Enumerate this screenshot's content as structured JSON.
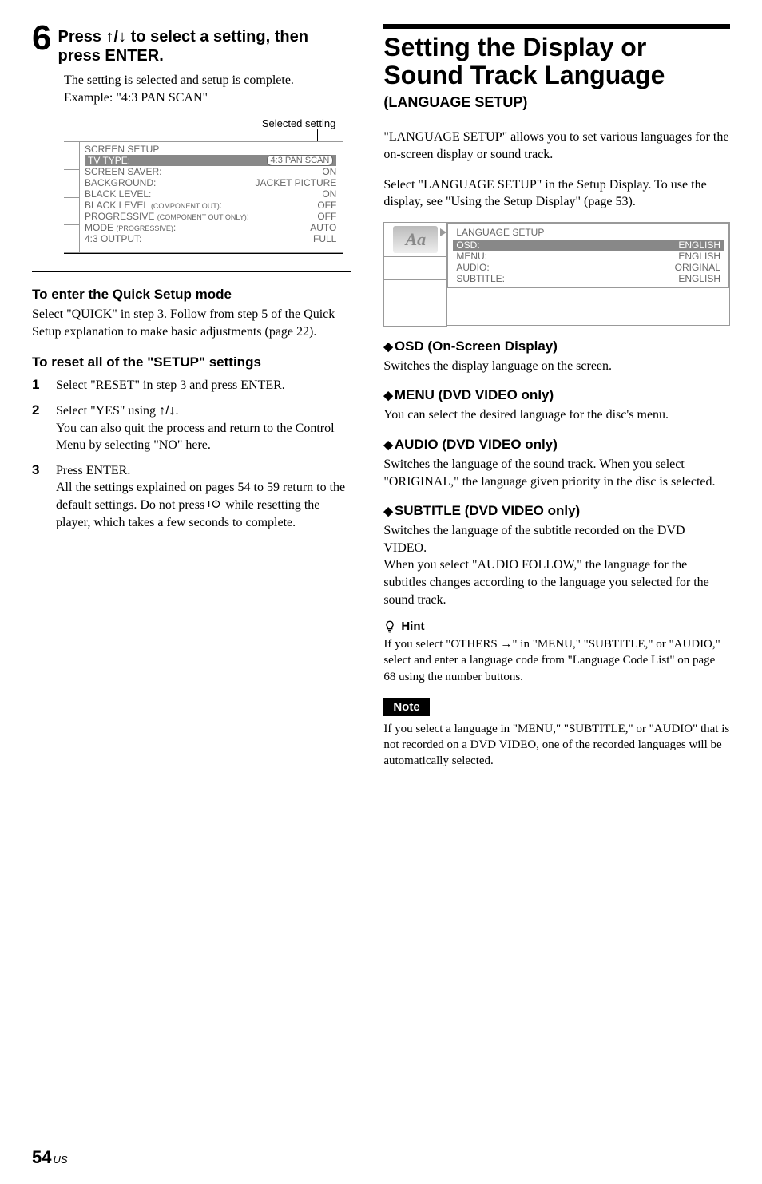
{
  "left": {
    "step_number": "6",
    "step_heading_a": "Press ",
    "step_heading_arrows": "↑/↓",
    "step_heading_b": " to select a setting, then press ENTER.",
    "body1": "The setting is selected and setup is complete.",
    "body2": "Example: \"4:3 PAN SCAN\"",
    "selected_label": "Selected setting",
    "osd": {
      "title": "SCREEN SETUP",
      "hl_label": "TV TYPE:",
      "hl_value": "4:3 PAN SCAN",
      "rows": [
        {
          "l": "SCREEN SAVER:",
          "r": "ON"
        },
        {
          "l": "BACKGROUND:",
          "r": "JACKET PICTURE"
        },
        {
          "l": "BLACK LEVEL:",
          "r": "ON"
        },
        {
          "l": "BLACK LEVEL (COMPONENT OUT):",
          "r": "OFF",
          "small": true
        },
        {
          "l": "PROGRESSIVE (COMPONENT OUT ONLY):",
          "r": "OFF",
          "small": true
        },
        {
          "l": "MODE (PROGRESSIVE):",
          "r": "AUTO",
          "small": true
        },
        {
          "l": "4:3 OUTPUT:",
          "r": "FULL"
        }
      ]
    },
    "quick_heading": "To enter the Quick Setup mode",
    "quick_body": "Select \"QUICK\" in step 3. Follow from step 5 of the Quick Setup explanation to make basic adjustments (page 22).",
    "reset_heading": "To reset all of the \"SETUP\" settings",
    "reset_steps": [
      {
        "n": "1",
        "t": "Select \"RESET\" in step 3 and press ENTER."
      },
      {
        "n": "2",
        "t_a": "Select \"YES\" using ",
        "t_arrows": "↑/↓",
        "t_b": ".\nYou can also quit the process and return to the Control Menu by selecting \"NO\" here."
      },
      {
        "n": "3",
        "t_a": "Press ENTER.\nAll the settings explained on pages 54 to 59 return to the default settings. Do not press ",
        "t_power": true,
        "t_b": " while resetting the player, which takes a few seconds to complete."
      }
    ]
  },
  "right": {
    "title1": "Setting the Display or",
    "title2": "Sound Track Language",
    "subtitle": "(LANGUAGE SETUP)",
    "intro": "\"LANGUAGE SETUP\" allows you to set various languages for the on-screen display or sound track.",
    "select_para": "Select \"LANGUAGE SETUP\" in the Setup Display. To use the display, see \"Using the Setup Display\" (page 53).",
    "menu": {
      "title": "LANGUAGE SETUP",
      "rows": [
        {
          "l": "OSD:",
          "r": "ENGLISH",
          "hl": true
        },
        {
          "l": "MENU:",
          "r": "ENGLISH"
        },
        {
          "l": "AUDIO:",
          "r": "ORIGINAL"
        },
        {
          "l": "SUBTITLE:",
          "r": "ENGLISH"
        }
      ],
      "icon_text": "Aa"
    },
    "sec_osd_h": "OSD (On-Screen Display)",
    "sec_osd_b": "Switches the display language on the screen.",
    "sec_menu_h": "MENU (DVD VIDEO only)",
    "sec_menu_b": "You can select the desired language for the disc's menu.",
    "sec_audio_h": "AUDIO (DVD VIDEO only)",
    "sec_audio_b": "Switches the language of the sound track. When you select \"ORIGINAL,\" the language given priority in the disc is selected.",
    "sec_sub_h": "SUBTITLE (DVD VIDEO only)",
    "sec_sub_b": "Switches the language of the subtitle recorded on the DVD VIDEO.\nWhen you select \"AUDIO FOLLOW,\" the language for the subtitles changes according to the language you selected for the sound track.",
    "hint_label": "Hint",
    "hint_body": "If you select \"OTHERS →\" in \"MENU,\" \"SUBTITLE,\" or \"AUDIO,\" select and enter a language code from \"Language Code List\" on page 68 using the number buttons.",
    "note_label": "Note",
    "note_body": "If you select a language in \"MENU,\" \"SUBTITLE,\" or \"AUDIO\" that is not recorded on a DVD VIDEO, one of the recorded languages will be automatically selected."
  },
  "footer": {
    "page": "54",
    "region": "US"
  }
}
